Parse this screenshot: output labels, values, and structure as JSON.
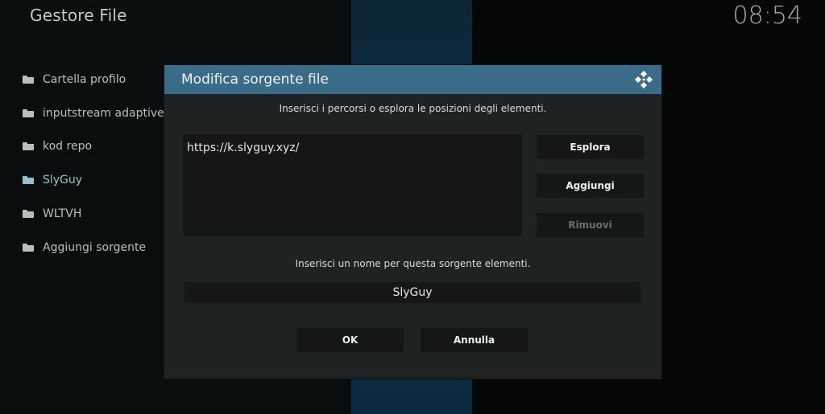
{
  "app": {
    "title": "Gestore File",
    "clock": "08:54"
  },
  "sidebar": {
    "items": [
      {
        "label": "Cartella profilo",
        "active": false
      },
      {
        "label": "inputstream adaptive",
        "active": false
      },
      {
        "label": "kod repo",
        "active": false
      },
      {
        "label": "SlyGuy",
        "active": true
      },
      {
        "label": "WLTVH",
        "active": false
      },
      {
        "label": "Aggiungi sorgente",
        "active": false
      }
    ]
  },
  "dialog": {
    "title": "Modifica sorgente file",
    "prompt_paths": "Inserisci i percorsi o esplora le posizioni degli elementi.",
    "paths": [
      "https://k.slyguy.xyz/"
    ],
    "buttons": {
      "browse": "Esplora",
      "add": "Aggiungi",
      "remove": "Rimuovi"
    },
    "prompt_name": "Inserisci un nome per questa sorgente elementi.",
    "name_value": "SlyGuy",
    "ok_label": "OK",
    "cancel_label": "Annulla"
  }
}
